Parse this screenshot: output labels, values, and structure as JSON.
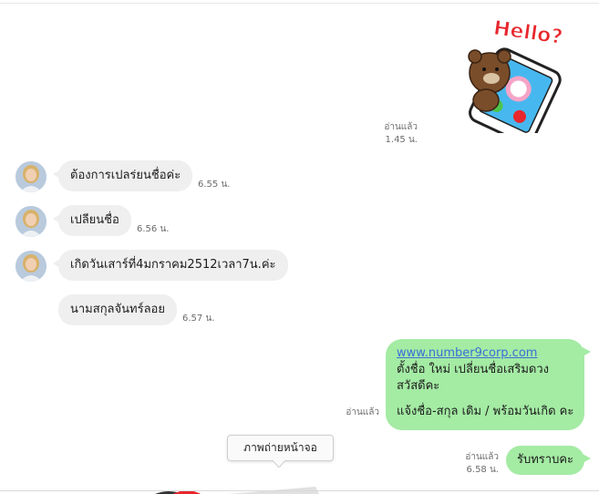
{
  "sticker": {
    "text": "Hello?"
  },
  "messages": [
    {
      "dir": "out",
      "type": "sticker",
      "read": "อ่านแล้ว",
      "time": "1.45 น."
    },
    {
      "dir": "in",
      "text": "ต้องการเปลร่ยนชื่อค่ะ",
      "time": "6.55 น."
    },
    {
      "dir": "in",
      "text": "เปลียนชื่อ",
      "time": "6.56 น."
    },
    {
      "dir": "in",
      "text": "เกิดวันเสาร์ที่4มกราคม2512เวลา7น.ค่ะ",
      "time": ""
    },
    {
      "dir": "in",
      "text": "นามสกุลจันทร์ลอย",
      "time": "6.57 น."
    },
    {
      "dir": "out",
      "link": "www.number9corp.com",
      "line1": "ตั้งชื่อ ใหม่ เปลี่ยนชื่อเสริมดวง",
      "line2": "สวัสดีคะ",
      "line3": "แจ้งชื่อ-สกุล เดิม / พร้อมวันเกิด คะ",
      "read": "อ่านแล้ว"
    },
    {
      "dir": "out",
      "text": "รับทราบคะ",
      "read": "อ่านแล้ว",
      "time": "6.58 น."
    }
  ],
  "tooltip": {
    "label": "ภาพถ่ายหน้าจอ"
  },
  "colors": {
    "incoming": "#efefef",
    "outgoing": "#a4eba4",
    "link": "#3a6fd8"
  }
}
